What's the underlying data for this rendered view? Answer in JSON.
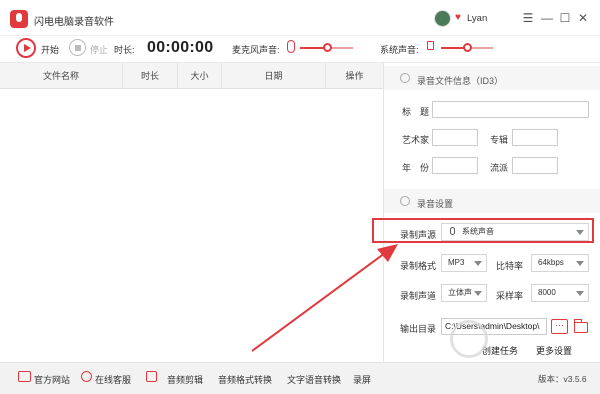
{
  "app": {
    "title": "闪电电脑录音软件",
    "user_name": "Lyan",
    "vip_glyph": "♥",
    "window_controls": [
      "☰",
      "—",
      "☐",
      "✕"
    ]
  },
  "toolbar": {
    "start_label": "开始",
    "stop_label": "停止",
    "duration_label": "时长:",
    "duration_value": "00:00:00",
    "mic_label": "麦克风声音:",
    "mic_level": 0.5,
    "system_label": "系统声音:",
    "system_level": 0.5
  },
  "file_table": {
    "columns": [
      "文件名称",
      "时长",
      "大小",
      "日期",
      "操作"
    ],
    "rows": []
  },
  "id3": {
    "section_title": "录音文件信息（ID3）",
    "title_label": "标　题",
    "title_value": "",
    "artist_label": "艺术家",
    "artist_value": "",
    "album_label": "专辑",
    "album_value": "",
    "year_label": "年　份",
    "year_value": "",
    "genre_label": "流派",
    "genre_value": ""
  },
  "settings": {
    "section_title": "录音设置",
    "source_label": "录制声源",
    "source_value": "系统声音",
    "format_label": "录制格式",
    "format_value": "MP3",
    "bitrate_label": "比特率",
    "bitrate_value": "64kbps",
    "channel_label": "录制声道",
    "channel_value": "立体声",
    "samplerate_label": "采样率",
    "samplerate_value": "8000",
    "output_label": "输出目录",
    "output_value": "C:\\Users\\admin\\Desktop\\",
    "more_button_label": "···",
    "create_task_label": "创建任务",
    "more_settings_label": "更多设置"
  },
  "bottom_bar": {
    "website_label": "官方网站",
    "service_label": "在线客服",
    "audio_cut_label": "音频剪辑",
    "format_convert_label": "音频格式转换",
    "tts_label": "文字语音转换",
    "screen_record_label": "录屏",
    "version_label": "版本：v3.5.6"
  },
  "colors": {
    "accent": "#e0393e"
  }
}
